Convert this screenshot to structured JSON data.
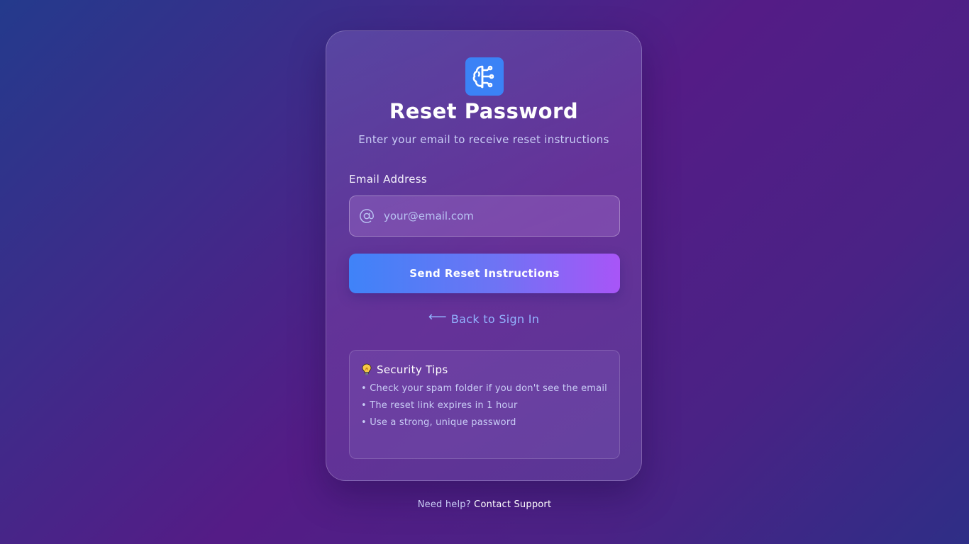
{
  "card": {
    "logo_icon": "brain-circuit-icon",
    "title": "Reset Password",
    "subtitle": "Enter your email to receive reset instructions"
  },
  "form": {
    "email_label": "Email Address",
    "email_icon": "at-sign-icon",
    "email_placeholder": "your@email.com",
    "email_value": "",
    "submit_label": "Send Reset Instructions"
  },
  "back_link": {
    "arrow": "⟵",
    "label": "Back to Sign In"
  },
  "security_tips": {
    "icon": "lightbulb-icon",
    "heading": "Security Tips",
    "items": [
      "• Check your spam folder if you don't see the email",
      "• The reset link expires in 1 hour",
      "• Use a strong, unique password"
    ]
  },
  "footer": {
    "help_text": "Need help?",
    "support_link": "Contact Support"
  },
  "colors": {
    "logo_bg": "#3b82f6",
    "button_gradient_start": "#3f83f8",
    "button_gradient_end": "#a855f7",
    "link": "#93b4ff",
    "muted_text": "#c9cdf6"
  }
}
